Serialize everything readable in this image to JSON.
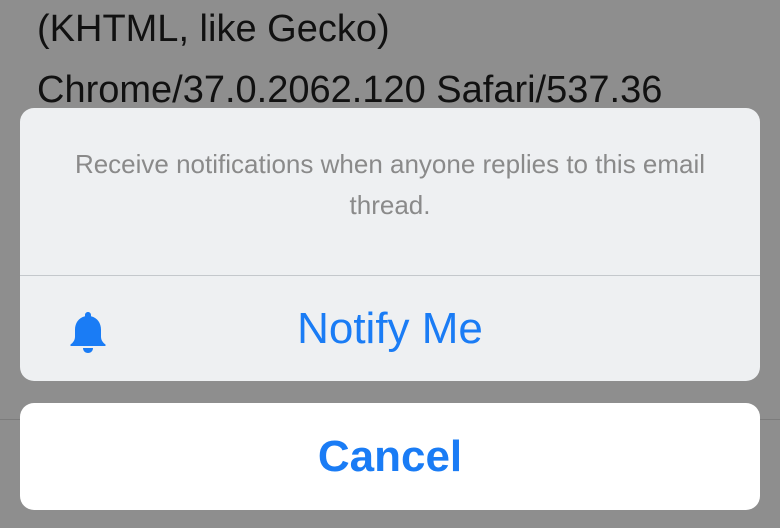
{
  "background": {
    "ua_line1": "(KHTML, like Gecko)",
    "ua_line2": "Chrome/37.0.2062.120 Safari/537.36"
  },
  "action_sheet": {
    "message": "Receive notifications when anyone replies to this email thread.",
    "notify": {
      "icon": "bell-icon",
      "label": "Notify Me"
    },
    "cancel_label": "Cancel"
  },
  "colors": {
    "accent": "#1a7cf5",
    "dim_overlay": "#8e8e8e",
    "sheet_background": "#eef0f2",
    "message_text": "#8a8a8a"
  }
}
